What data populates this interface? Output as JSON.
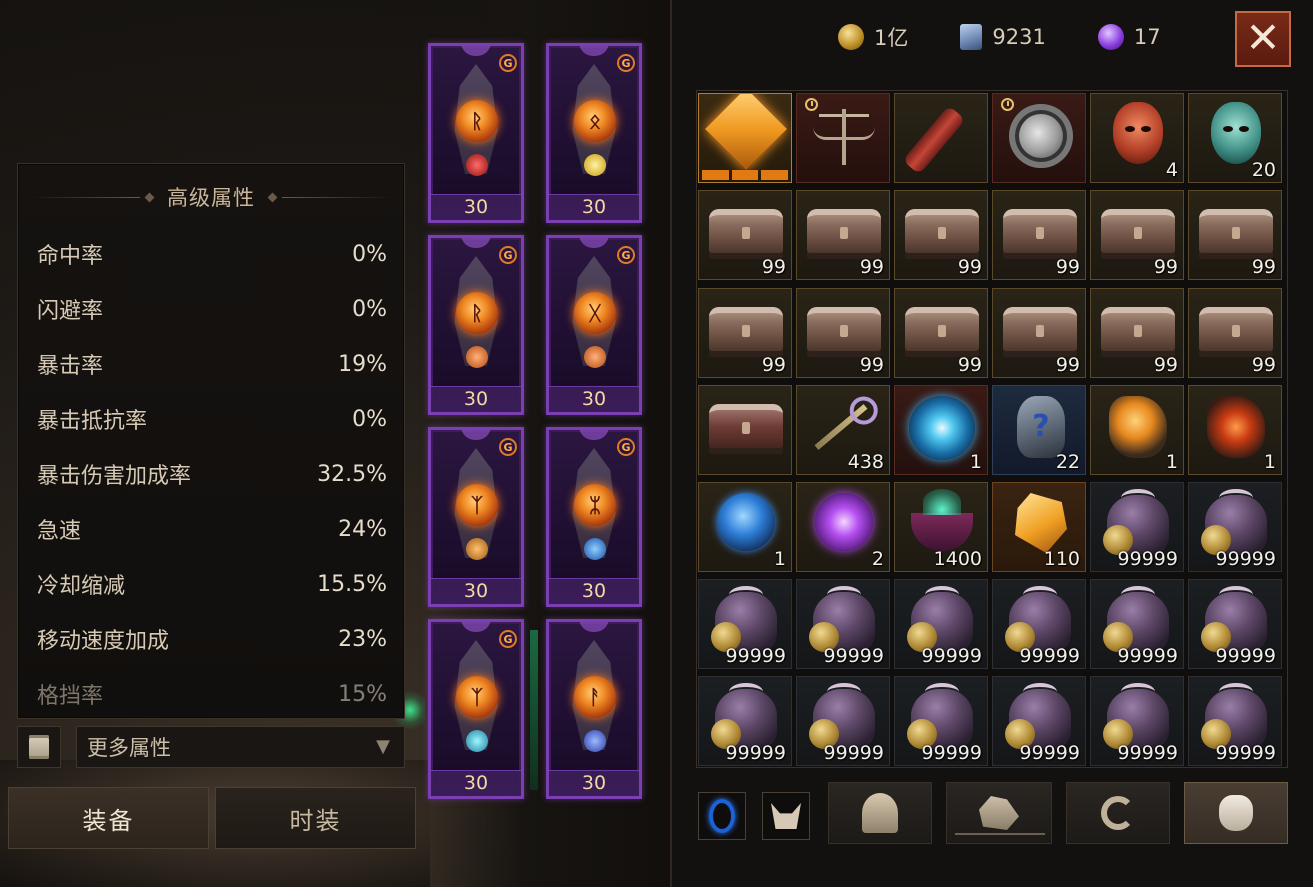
{
  "currency": [
    {
      "icon": "gold-coin-icon",
      "value": "1亿"
    },
    {
      "icon": "crystal-card-icon",
      "value": "9231"
    },
    {
      "icon": "purple-orb-icon",
      "value": "17"
    }
  ],
  "close_label": "✕",
  "stats": {
    "title": "高级属性",
    "rows": [
      {
        "label": "命中率",
        "value": "0%"
      },
      {
        "label": "闪避率",
        "value": "0%"
      },
      {
        "label": "暴击率",
        "value": "19%"
      },
      {
        "label": "暴击抵抗率",
        "value": "0%"
      },
      {
        "label": "暴击伤害加成率",
        "value": "32.5%"
      },
      {
        "label": "急速",
        "value": "24%"
      },
      {
        "label": "冷却缩减",
        "value": "15.5%"
      },
      {
        "label": "移动速度加成",
        "value": "23%"
      },
      {
        "label": "格挡率",
        "value": "15%"
      }
    ],
    "more_label": "更多属性",
    "more_arrow": "▼"
  },
  "tabs": {
    "equip": "装备",
    "fashion": "时装"
  },
  "equipment": [
    {
      "level": "30",
      "rune": "ᚱ",
      "gem": "red"
    },
    {
      "level": "30",
      "rune": "ᛟ",
      "gem": "gold"
    },
    {
      "level": "30",
      "rune": "ᚱ",
      "gem": "orange"
    },
    {
      "level": "30",
      "rune": "ᚷ",
      "gem": "orange"
    },
    {
      "level": "30",
      "rune": "ᛉ",
      "gem": "orange"
    },
    {
      "level": "30",
      "rune": "ᛯ",
      "gem": "blue"
    },
    {
      "level": "30",
      "rune": "ᛉ",
      "gem": "teal"
    },
    {
      "level": "30",
      "rune": "ᚨ",
      "gem": "blue"
    }
  ],
  "tier_badge": "G",
  "inventory": {
    "row1": [
      {
        "item": "legendary-diamond",
        "qty": ""
      },
      {
        "item": "scale",
        "qty": ""
      },
      {
        "item": "scroll",
        "qty": ""
      },
      {
        "item": "stone-disc",
        "qty": ""
      },
      {
        "item": "red-mask",
        "qty": "4"
      },
      {
        "item": "teal-mask",
        "qty": "20"
      }
    ],
    "chest_qty": "99",
    "row4": [
      {
        "item": "red-chest",
        "qty": ""
      },
      {
        "item": "key",
        "qty": "438"
      },
      {
        "item": "vortex",
        "qty": "1"
      },
      {
        "item": "mystery-stone",
        "qty": "22",
        "glyph": "?"
      },
      {
        "item": "gold-ore",
        "qty": "1"
      },
      {
        "item": "lava-ore",
        "qty": "1"
      }
    ],
    "row5": [
      {
        "item": "blue-sphere",
        "qty": "1"
      },
      {
        "item": "purple-sphere",
        "qty": "2"
      },
      {
        "item": "cauldron",
        "qty": "1400"
      },
      {
        "item": "amber-crystal",
        "qty": "110"
      },
      {
        "item": "coin-pile",
        "qty": "99999"
      },
      {
        "item": "coin-pile",
        "qty": "99999"
      }
    ],
    "pile_qty": "99999"
  },
  "categories": [
    "ring-icon",
    "demon-icon",
    "helmet-icon",
    "gauntlet-icon",
    "swirl-icon",
    "bag-icon"
  ]
}
